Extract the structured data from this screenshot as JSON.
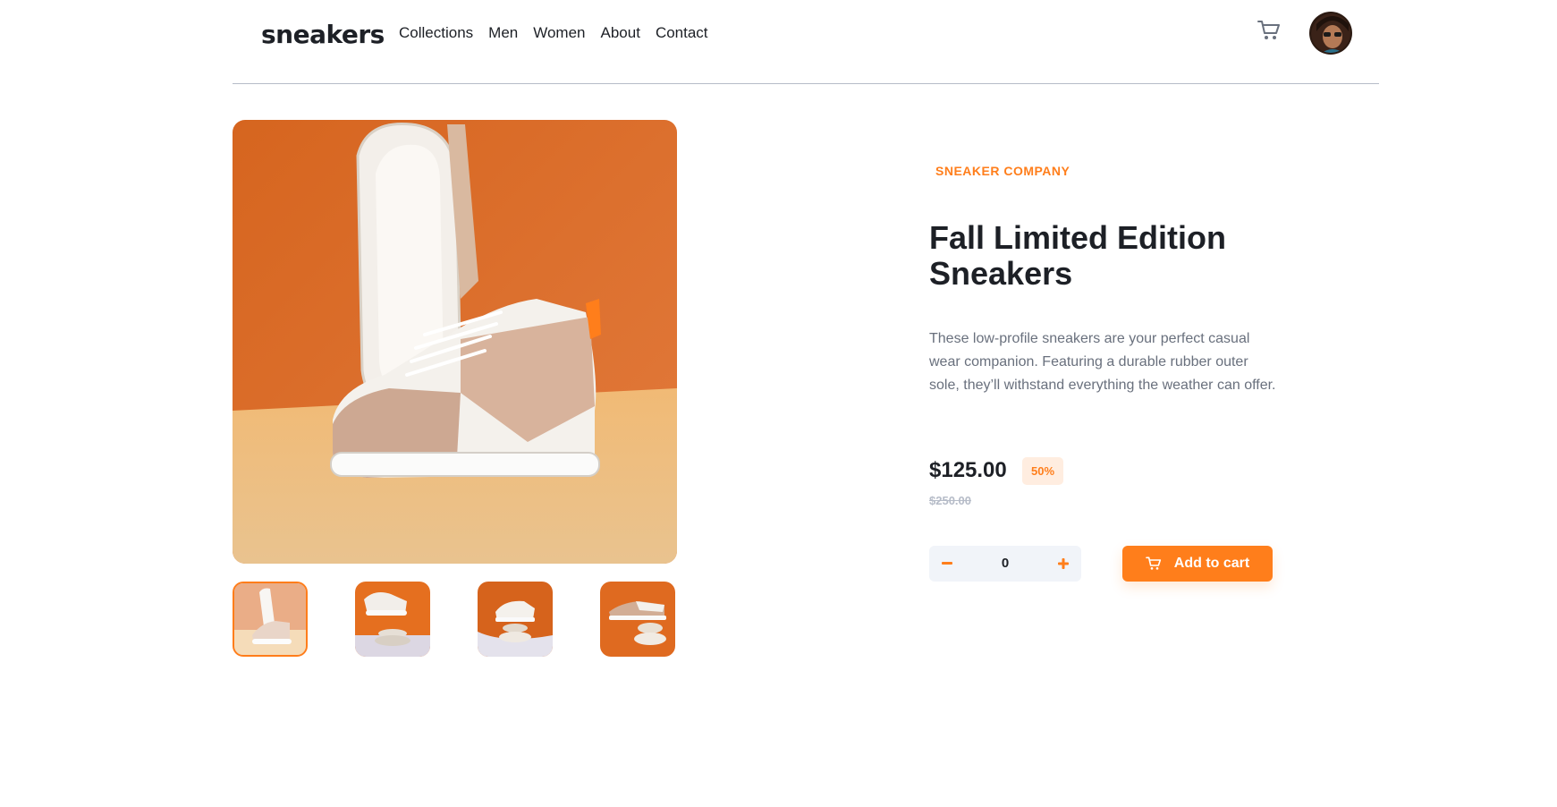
{
  "header": {
    "logo": "sneakers",
    "nav": [
      "Collections",
      "Men",
      "Women",
      "About",
      "Contact"
    ]
  },
  "product": {
    "company": "SNEAKER COMPANY",
    "title": "Fall Limited Edition Sneakers",
    "description": "These low-profile sneakers are your perfect casual wear companion. Featuring a durable rubber outer sole, they’ll withstand everything the weather can offer.",
    "price": "$125.00",
    "discount": "50%",
    "original_price": "$250.00"
  },
  "cart": {
    "quantity": "0",
    "add_label": "Add to cart"
  },
  "colors": {
    "accent": "#ff7e1b",
    "accent_pale": "#ffede0",
    "text_dark": "#1d2026",
    "text_gray": "#69707d",
    "divider": "#b6bcc8"
  },
  "icons": {
    "cart": "cart-icon",
    "minus": "minus-icon",
    "plus": "plus-icon",
    "avatar": "user-avatar"
  }
}
